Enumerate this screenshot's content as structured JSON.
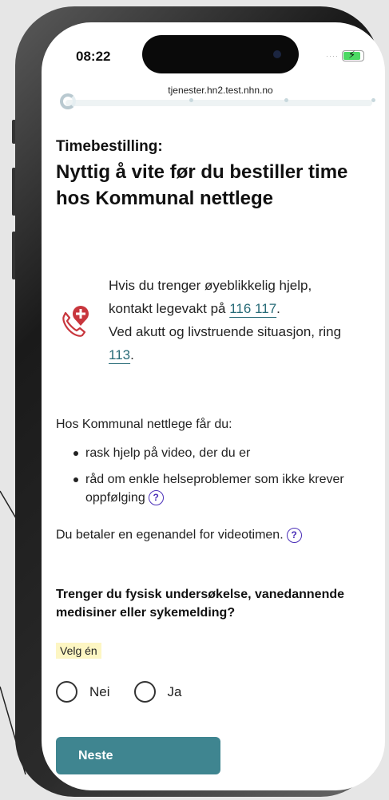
{
  "status_bar": {
    "time": "08:22"
  },
  "browser": {
    "url": "tjenester.hn2.test.nhn.no"
  },
  "page": {
    "eyebrow": "Timebestilling:",
    "title": "Nyttig å vite før du bestiller time hos Kommunal nettlege"
  },
  "urgent": {
    "line1": "Hvis du trenger øyeblikkelig hjelp,",
    "line2_prefix": "kontakt legevakt på",
    "legevakt_number": "116 117",
    "line2_suffix": ".",
    "line3": "Ved akutt og livstruende situasjon, ring",
    "emergency_number": "113",
    "line4_suffix": ".",
    "icon": "phone-medical-icon"
  },
  "benefits": {
    "intro": "Hos Kommunal nettlege får du:",
    "items": [
      "rask hjelp på video, der du er",
      "råd om enkle helseproblemer som ikke krever oppfølging"
    ]
  },
  "fee": {
    "text": "Du betaler en egenandel for videotimen."
  },
  "help_icon_glyph": "?",
  "question": {
    "text": "Trenger du fysisk undersøkelse, vanedannende medisiner eller sykemelding?",
    "hint": "Velg én",
    "options": [
      "Nei",
      "Ja"
    ]
  },
  "actions": {
    "next_label": "Neste"
  },
  "colors": {
    "primary_button": "#3f8590",
    "link": "#276b77",
    "help_icon": "#4a2fb8",
    "urgent_icon": "#c8363d",
    "hint_background": "#fdf6c3"
  }
}
